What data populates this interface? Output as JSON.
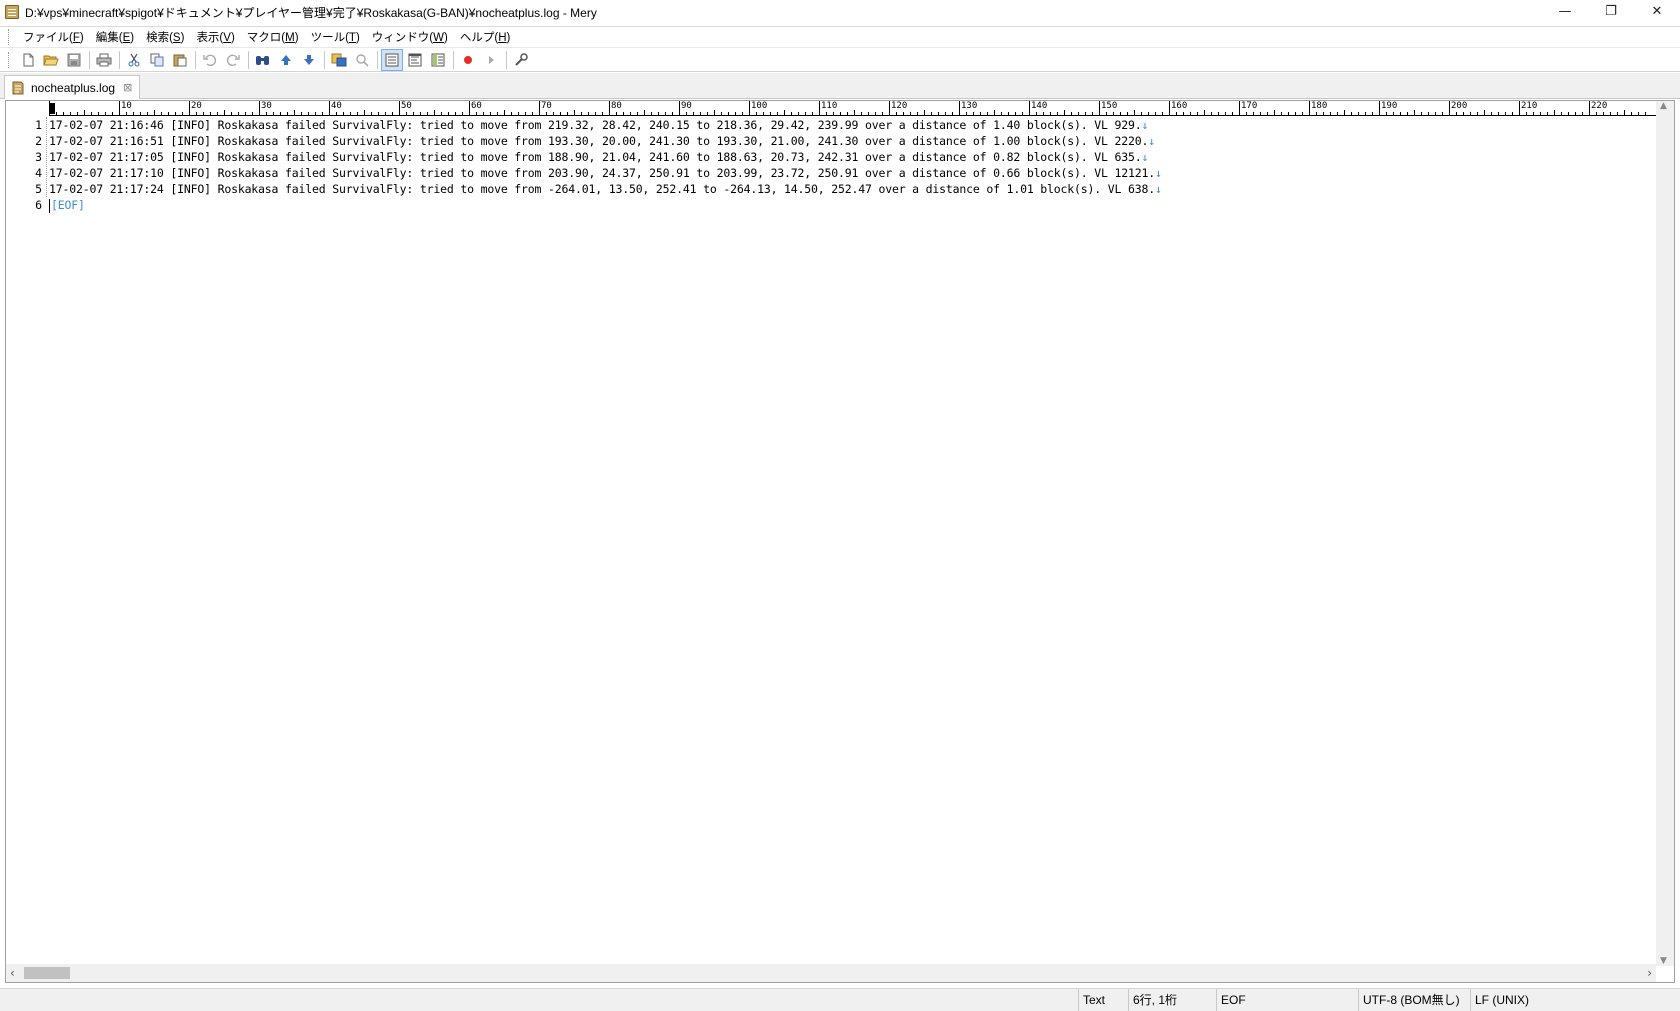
{
  "window": {
    "title": "D:¥vps¥minecraft¥spigot¥ドキュメント¥プレイヤー管理¥完了¥Roskakasa(G-BAN)¥nocheatplus.log - Mery",
    "minimize": "—",
    "restore": "❐",
    "close": "✕"
  },
  "menu": [
    {
      "label": "ファイル(",
      "key": "F",
      "end": ")"
    },
    {
      "label": "編集(",
      "key": "E",
      "end": ")"
    },
    {
      "label": "検索(",
      "key": "S",
      "end": ")"
    },
    {
      "label": "表示(",
      "key": "V",
      "end": ")"
    },
    {
      "label": "マクロ(",
      "key": "M",
      "end": ")"
    },
    {
      "label": "ツール(",
      "key": "T",
      "end": ")"
    },
    {
      "label": "ウィンドウ(",
      "key": "W",
      "end": ")"
    },
    {
      "label": "ヘルプ(",
      "key": "H",
      "end": ")"
    }
  ],
  "toolbar_icons": [
    "new-file-icon",
    "open-folder-icon",
    "save-icon",
    "print-icon",
    "cut-icon",
    "copy-icon",
    "paste-icon",
    "undo-icon",
    "redo-icon",
    "find-icon",
    "find-prev-icon",
    "find-next-icon",
    "replace-icon",
    "highlight-clear-icon",
    "wrap-none-icon",
    "wrap-window-icon",
    "wrap-ruler-icon",
    "macro-record-icon",
    "macro-play-icon",
    "options-icon"
  ],
  "tab": {
    "label": "nocheatplus.log",
    "close": "⊠"
  },
  "ruler": {
    "labels": [
      "10",
      "20",
      "30",
      "40",
      "50",
      "60",
      "70",
      "80",
      "90",
      "100",
      "110",
      "120",
      "130",
      "140",
      "150",
      "160",
      "170",
      "180",
      "190",
      "200",
      "210",
      "220"
    ]
  },
  "lines": [
    {
      "num": "1",
      "text": "17-02-07 21:16:46 [INFO] Roskakasa failed SurvivalFly: tried to move from 219.32, 28.42, 240.15 to 218.36, 29.42, 239.99 over a distance of 1.40 block(s). VL 929.",
      "eol": "↓"
    },
    {
      "num": "2",
      "text": "17-02-07 21:16:51 [INFO] Roskakasa failed SurvivalFly: tried to move from 193.30, 20.00, 241.30 to 193.30, 21.00, 241.30 over a distance of 1.00 block(s). VL 2220.",
      "eol": "↓"
    },
    {
      "num": "3",
      "text": "17-02-07 21:17:05 [INFO] Roskakasa failed SurvivalFly: tried to move from 188.90, 21.04, 241.60 to 188.63, 20.73, 242.31 over a distance of 0.82 block(s). VL 635.",
      "eol": "↓"
    },
    {
      "num": "4",
      "text": "17-02-07 21:17:10 [INFO] Roskakasa failed SurvivalFly: tried to move from 203.90, 24.37, 250.91 to 203.99, 23.72, 250.91 over a distance of 0.66 block(s). VL 12121.",
      "eol": "↓"
    },
    {
      "num": "5",
      "text": "17-02-07 21:17:24 [INFO] Roskakasa failed SurvivalFly: tried to move from -264.01, 13.50, 252.41 to -264.13, 14.50, 252.47 over a distance of 1.01 block(s). VL 638.",
      "eol": "↓"
    },
    {
      "num": "6",
      "text": "",
      "eol": "[EOF]"
    }
  ],
  "status": {
    "mode": "Text",
    "position": "6行, 1桁",
    "eof": "EOF",
    "encoding": "UTF-8 (BOM無し)",
    "line_ending": "LF (UNIX)"
  },
  "colors": {
    "eol_marker": "#3a8fd6",
    "record_icon": "#e0302a"
  }
}
